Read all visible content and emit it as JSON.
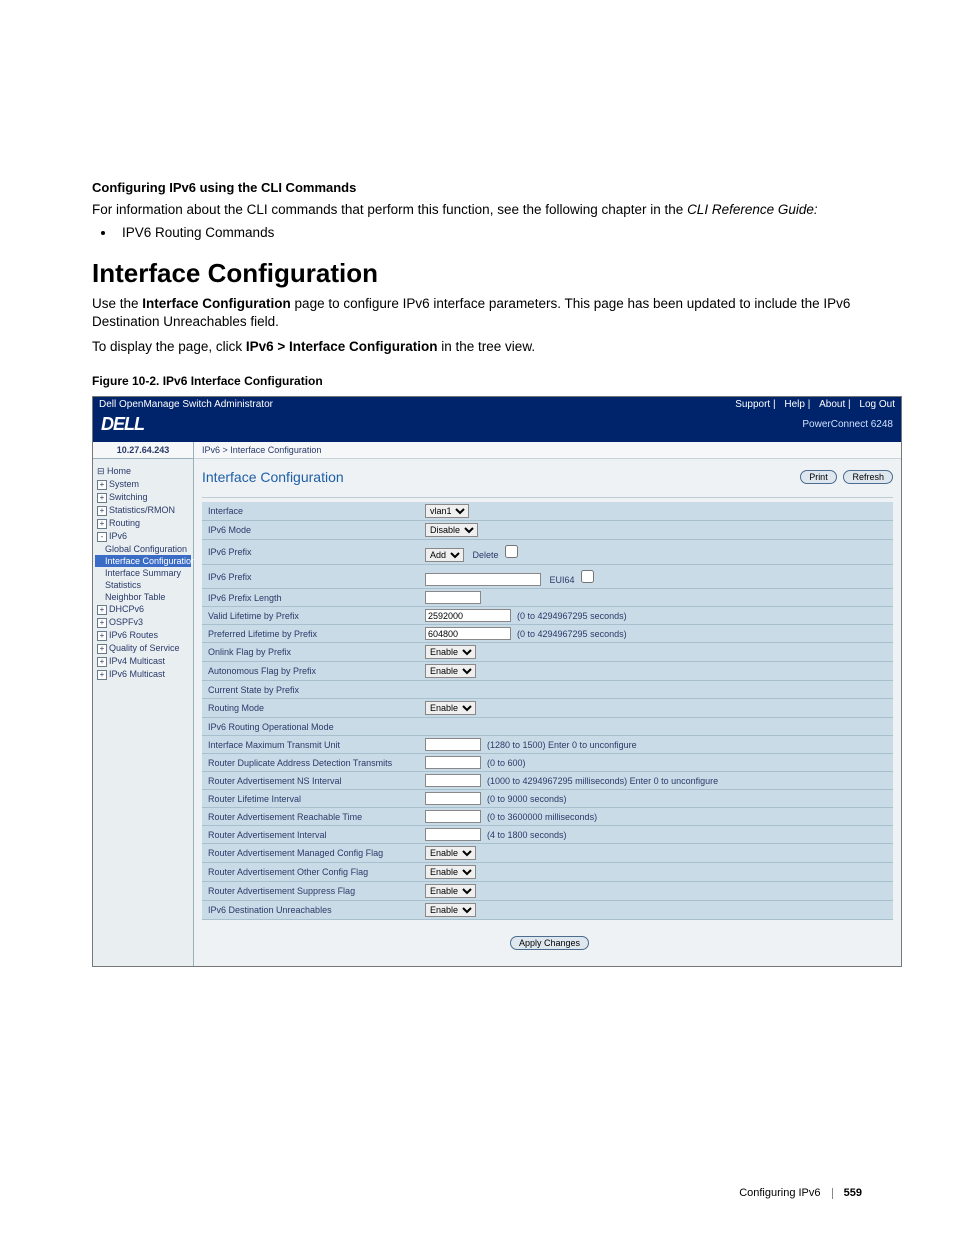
{
  "doc": {
    "cli_heading": "Configuring IPv6 using the CLI Commands",
    "cli_para_a": "For information about the CLI commands that perform this function, see the following chapter in the ",
    "cli_para_b": "CLI Reference Guide:",
    "bullet1": "IPV6 Routing Commands",
    "section_title": "Interface Configuration",
    "para1_a": "Use the ",
    "para1_b": "Interface Configuration",
    "para1_c": " page to configure IPv6 interface parameters. This page has been updated to include the IPv6 Destination Unreachables field.",
    "para2_a": "To display the page, click ",
    "para2_b": "IPv6 > Interface Configuration",
    "para2_c": " in the tree view.",
    "fig_caption": "Figure 10-2.    IPv6 Interface Configuration",
    "footer_label": "Configuring IPv6",
    "page_num": "559"
  },
  "scr": {
    "top_title": "Dell OpenManage Switch Administrator",
    "top_links": [
      "Support",
      "Help",
      "About",
      "Log Out"
    ],
    "logo": "DELL",
    "model": "PowerConnect 6248",
    "ip": "10.27.64.243",
    "crumb_a": "IPv6",
    "crumb_sep": " > ",
    "crumb_b": "Interface Configuration",
    "page_title": "Interface Configuration",
    "btn_print": "Print",
    "btn_refresh": "Refresh",
    "btn_apply": "Apply Changes",
    "tree": [
      {
        "lvl": 0,
        "tog": "",
        "label": "⊟ Home"
      },
      {
        "lvl": 0,
        "tog": "+",
        "label": "System"
      },
      {
        "lvl": 0,
        "tog": "+",
        "label": "Switching"
      },
      {
        "lvl": 0,
        "tog": "+",
        "label": "Statistics/RMON"
      },
      {
        "lvl": 0,
        "tog": "+",
        "label": "Routing"
      },
      {
        "lvl": 0,
        "tog": "-",
        "label": "IPv6"
      },
      {
        "lvl": 1,
        "tog": "",
        "label": "Global Configuration"
      },
      {
        "lvl": 1,
        "tog": "",
        "label": "Interface Configuration",
        "sel": true
      },
      {
        "lvl": 1,
        "tog": "",
        "label": "Interface Summary"
      },
      {
        "lvl": 1,
        "tog": "",
        "label": "Statistics"
      },
      {
        "lvl": 1,
        "tog": "",
        "label": "Neighbor Table"
      },
      {
        "lvl": 0,
        "tog": "+",
        "label": "DHCPv6"
      },
      {
        "lvl": 0,
        "tog": "+",
        "label": "OSPFv3"
      },
      {
        "lvl": 0,
        "tog": "+",
        "label": "IPv6 Routes"
      },
      {
        "lvl": 0,
        "tog": "+",
        "label": "Quality of Service"
      },
      {
        "lvl": 0,
        "tog": "+",
        "label": "IPv4 Multicast"
      },
      {
        "lvl": 0,
        "tog": "+",
        "label": "IPv6 Multicast"
      }
    ],
    "rows": [
      {
        "label": "Interface",
        "type": "select",
        "value": "vlan1"
      },
      {
        "label": "IPv6 Mode",
        "type": "select",
        "value": "Disable"
      },
      {
        "label": "IPv6 Prefix",
        "type": "prefix_addsel",
        "value": "Add",
        "extra_label": "Delete",
        "extra_type": "checkbox"
      },
      {
        "label": "IPv6 Prefix",
        "type": "text_wide",
        "value": "",
        "hint": "EUI64",
        "hint_check": true
      },
      {
        "label": "IPv6 Prefix Length",
        "type": "text_small",
        "value": ""
      },
      {
        "label": "Valid Lifetime by Prefix",
        "type": "text_med",
        "value": "2592000",
        "hint": "(0 to 4294967295 seconds)"
      },
      {
        "label": "Preferred Lifetime by Prefix",
        "type": "text_med",
        "value": "604800",
        "hint": "(0 to 4294967295 seconds)"
      },
      {
        "label": "Onlink Flag by Prefix",
        "type": "select",
        "value": "Enable"
      },
      {
        "label": "Autonomous Flag by Prefix",
        "type": "select",
        "value": "Enable"
      },
      {
        "label": "Current State by Prefix",
        "type": "blank"
      },
      {
        "label": "Routing Mode",
        "type": "select",
        "value": "Enable"
      },
      {
        "label": "IPv6 Routing Operational Mode",
        "type": "blank"
      },
      {
        "label": "Interface Maximum Transmit Unit",
        "type": "text_small",
        "value": "",
        "hint": "(1280 to 1500) Enter 0 to unconfigure"
      },
      {
        "label": "Router Duplicate Address Detection Transmits",
        "type": "text_small",
        "value": "",
        "hint": "(0 to 600)"
      },
      {
        "label": "Router Advertisement NS Interval",
        "type": "text_small",
        "value": "",
        "hint": "(1000 to 4294967295 milliseconds) Enter 0 to unconfigure"
      },
      {
        "label": "Router Lifetime Interval",
        "type": "text_small",
        "value": "",
        "hint": "(0 to 9000 seconds)"
      },
      {
        "label": "Router Advertisement Reachable Time",
        "type": "text_small",
        "value": "",
        "hint": "(0 to 3600000 milliseconds)"
      },
      {
        "label": "Router Advertisement Interval",
        "type": "text_small",
        "value": "",
        "hint": "(4 to 1800 seconds)"
      },
      {
        "label": "Router Advertisement Managed Config Flag",
        "type": "select",
        "value": "Enable"
      },
      {
        "label": "Router Advertisement Other Config Flag",
        "type": "select",
        "value": "Enable"
      },
      {
        "label": "Router Advertisement Suppress Flag",
        "type": "select",
        "value": "Enable"
      },
      {
        "label": "IPv6 Destination Unreachables",
        "type": "select",
        "value": "Enable"
      }
    ]
  }
}
